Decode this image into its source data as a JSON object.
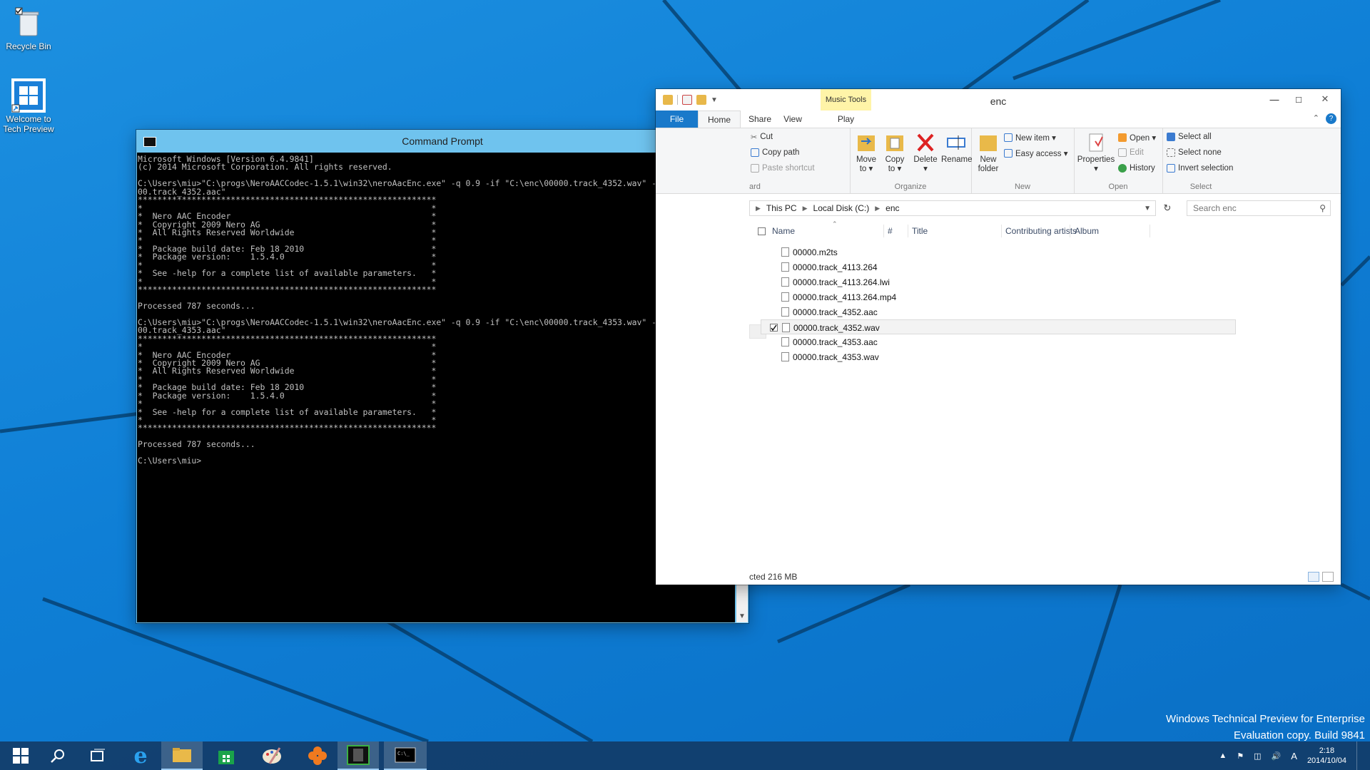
{
  "desktop": {
    "icons": [
      {
        "label": "Recycle Bin"
      },
      {
        "label": "Welcome to\nTech Preview"
      }
    ],
    "watermark": {
      "line1": "Windows Technical Preview for Enterprise",
      "line2": "Evaluation copy. Build 9841"
    }
  },
  "cmd": {
    "title": "Command Prompt",
    "lines": [
      "Microsoft Windows [Version 6.4.9841]",
      "(c) 2014 Microsoft Corporation. All rights reserved.",
      "",
      "C:\\Users\\miu>\"C:\\progs\\NeroAACCodec-1.5.1\\win32\\neroAacEnc.exe\" -q 0.9 -if \"C:\\enc\\00000.track_4352.wav\" -of \"C:\\enc\\000",
      "00.track_4352.aac\"",
      "*************************************************************",
      "*                                                           *",
      "*  Nero AAC Encoder                                         *",
      "*  Copyright 2009 Nero AG                                   *",
      "*  All Rights Reserved Worldwide                            *",
      "*                                                           *",
      "*  Package build date: Feb 18 2010                          *",
      "*  Package version:    1.5.4.0                              *",
      "*                                                           *",
      "*  See -help for a complete list of available parameters.   *",
      "*                                                           *",
      "*************************************************************",
      "",
      "Processed 787 seconds...",
      "",
      "C:\\Users\\miu>\"C:\\progs\\NeroAACCodec-1.5.1\\win32\\neroAacEnc.exe\" -q 0.9 -if \"C:\\enc\\00000.track_4353.wav\" -of \"C:\\enc\\000",
      "00.track_4353.aac\"",
      "*************************************************************",
      "*                                                           *",
      "*  Nero AAC Encoder                                         *",
      "*  Copyright 2009 Nero AG                                   *",
      "*  All Rights Reserved Worldwide                            *",
      "*                                                           *",
      "*  Package build date: Feb 18 2010                          *",
      "*  Package version:    1.5.4.0                              *",
      "*                                                           *",
      "*  See -help for a complete list of available parameters.   *",
      "*                                                           *",
      "*************************************************************",
      "",
      "Processed 787 seconds...",
      "",
      "C:\\Users\\miu>"
    ]
  },
  "explorer": {
    "title": "enc",
    "context_tab": "Music Tools",
    "tabs": {
      "file": "File",
      "home": "Home",
      "share": "Share",
      "view": "View",
      "play": "Play"
    },
    "ribbon": {
      "clipboard": {
        "cut": "Cut",
        "copy_path": "Copy path",
        "paste_shortcut": "Paste shortcut",
        "label": "ard"
      },
      "organize": {
        "move_to": "Move\nto ▾",
        "copy_to": "Copy\nto ▾",
        "delete": "Delete\n▾",
        "rename": "Rename",
        "label": "Organize"
      },
      "new": {
        "new_folder": "New\nfolder",
        "new_item": "New item ▾",
        "easy_access": "Easy access ▾",
        "label": "New"
      },
      "open": {
        "properties": "Properties\n▾",
        "open": "Open ▾",
        "edit": "Edit",
        "history": "History",
        "label": "Open"
      },
      "select": {
        "select_all": "Select all",
        "select_none": "Select none",
        "invert_selection": "Invert selection",
        "label": "Select"
      }
    },
    "address": {
      "this_pc": "This PC",
      "local_disk": "Local Disk (C:)",
      "enc": "enc"
    },
    "search_placeholder": "Search enc",
    "columns": {
      "name": "Name",
      "number": "#",
      "title": "Title",
      "contributing_artists": "Contributing artists",
      "album": "Album"
    },
    "files": [
      {
        "name": "00000.m2ts",
        "selected": false
      },
      {
        "name": "00000.track_4113.264",
        "selected": false
      },
      {
        "name": "00000.track_4113.264.lwi",
        "selected": false
      },
      {
        "name": "00000.track_4113.264.mp4",
        "selected": false
      },
      {
        "name": "00000.track_4352.aac",
        "selected": false
      },
      {
        "name": "00000.track_4352.wav",
        "selected": true
      },
      {
        "name": "00000.track_4353.aac",
        "selected": false
      },
      {
        "name": "00000.track_4353.wav",
        "selected": false
      }
    ],
    "status": "cted  216 MB"
  },
  "taskbar": {
    "clock_time": "2:18",
    "clock_date": "2014/10/04",
    "ime": "A"
  },
  "colors": {
    "accent": "#1979ca",
    "close": "#c7343a",
    "cmd_frame": "#6fc3ee",
    "music_tools": "#fff4a8"
  }
}
